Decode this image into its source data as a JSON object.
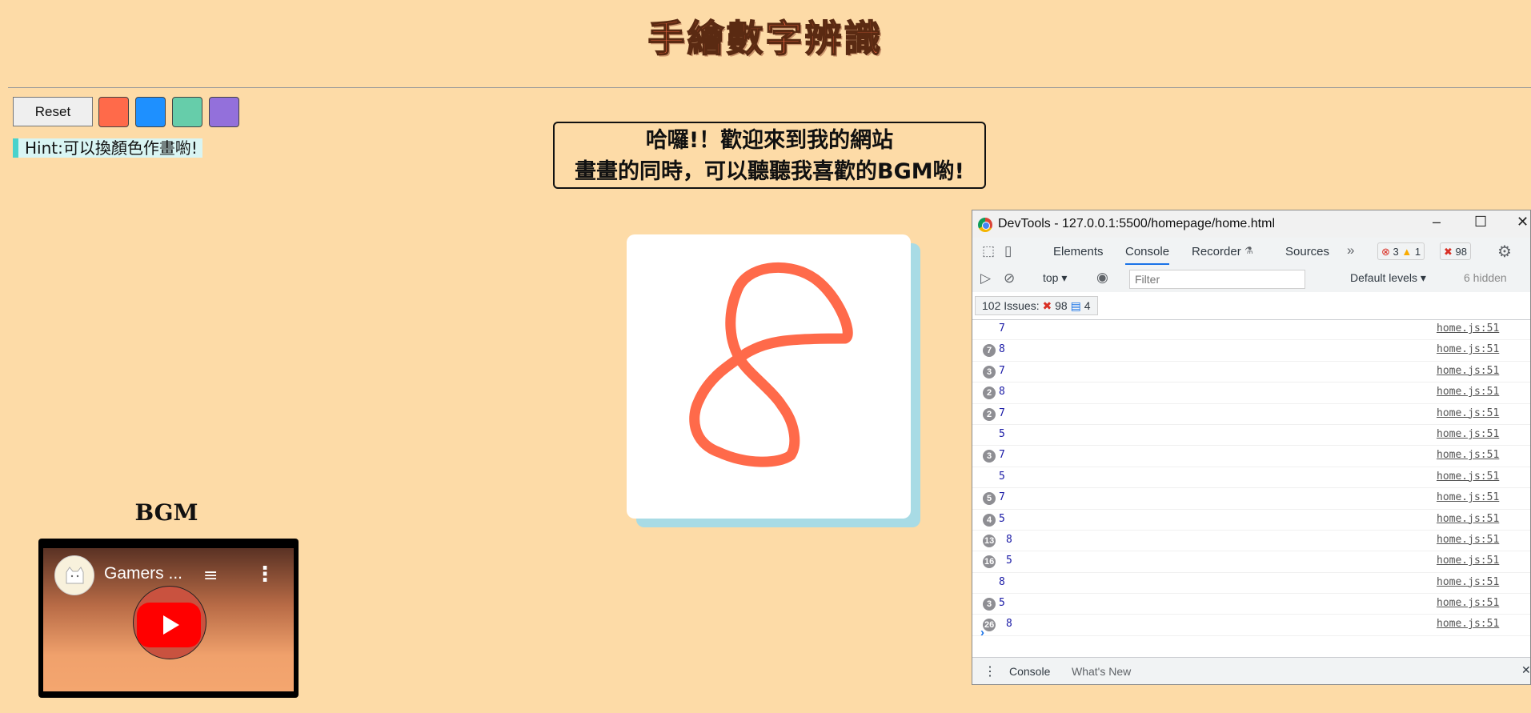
{
  "page": {
    "title": "手繪數字辨識",
    "reset_label": "Reset",
    "hint": "Hint:可以換顏色作畫喲!",
    "welcome_line1": "哈囉!！歡迎來到我的網站",
    "welcome_line2": "畫畫的同時，可以聽聽我喜歡的BGM喲!",
    "bgm_title": "BGM",
    "video_title": "Gamers ...",
    "colors": {
      "page_bg": "#fddba7",
      "stroke": "#ff6a4a",
      "swatches": [
        "#ff6a4a",
        "#1e90ff",
        "#66cdaa",
        "#9370db"
      ]
    }
  },
  "devtools": {
    "window_title": "DevTools - 127.0.0.1:5500/homepage/home.html",
    "tabs": [
      "Elements",
      "Console",
      "Recorder",
      "Sources"
    ],
    "active_tab": "Console",
    "error_count": "3",
    "warning_count": "1",
    "issue_badge_count": "98",
    "context": "top",
    "filter_placeholder": "Filter",
    "levels": "Default levels",
    "hidden": "6 hidden",
    "issues_label": "102 Issues:",
    "issues_errors": "98",
    "issues_info": "4",
    "log": [
      {
        "count": "",
        "value": "7",
        "source": "home.js:51"
      },
      {
        "count": "7",
        "value": "8",
        "source": "home.js:51"
      },
      {
        "count": "3",
        "value": "7",
        "source": "home.js:51"
      },
      {
        "count": "2",
        "value": "8",
        "source": "home.js:51"
      },
      {
        "count": "2",
        "value": "7",
        "source": "home.js:51"
      },
      {
        "count": "",
        "value": "5",
        "source": "home.js:51"
      },
      {
        "count": "3",
        "value": "7",
        "source": "home.js:51"
      },
      {
        "count": "",
        "value": "5",
        "source": "home.js:51"
      },
      {
        "count": "5",
        "value": "7",
        "source": "home.js:51"
      },
      {
        "count": "4",
        "value": "5",
        "source": "home.js:51"
      },
      {
        "count": "13",
        "value": "8",
        "source": "home.js:51"
      },
      {
        "count": "16",
        "value": "5",
        "source": "home.js:51"
      },
      {
        "count": "",
        "value": "8",
        "source": "home.js:51"
      },
      {
        "count": "3",
        "value": "5",
        "source": "home.js:51"
      },
      {
        "count": "26",
        "value": "8",
        "source": "home.js:51"
      }
    ],
    "prompt": "›",
    "drawer_tabs": [
      "Console",
      "What's New"
    ]
  }
}
